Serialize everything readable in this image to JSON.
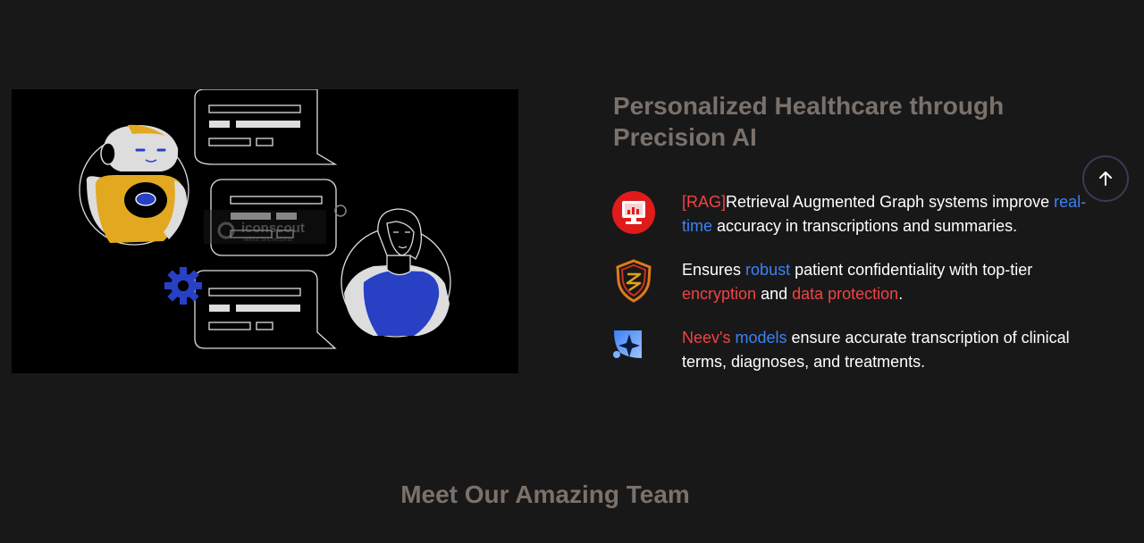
{
  "illustration": {
    "watermark_brand": "iconscout",
    "watermark_author": "Nikita Shcherbina"
  },
  "section": {
    "heading": "Personalized Healthcare through Precision AI",
    "features": [
      {
        "icon": "monitor-analytics-icon",
        "parts": [
          {
            "text": "[RAG]",
            "color": "red"
          },
          {
            "text": "Retrieval Augmented Graph systems improve ",
            "color": "white"
          },
          {
            "text": "real-time",
            "color": "blue"
          },
          {
            "text": " accuracy in transcriptions and summaries.",
            "color": "white"
          }
        ]
      },
      {
        "icon": "shield-icon",
        "parts": [
          {
            "text": "Ensures ",
            "color": "white"
          },
          {
            "text": "robust",
            "color": "blue"
          },
          {
            "text": " patient confidentiality with top-tier ",
            "color": "white"
          },
          {
            "text": "encryption",
            "color": "red"
          },
          {
            "text": " and ",
            "color": "white"
          },
          {
            "text": "data protection",
            "color": "red"
          },
          {
            "text": ".",
            "color": "white"
          }
        ]
      },
      {
        "icon": "sparkle-model-icon",
        "parts": [
          {
            "text": "Neev's",
            "color": "red"
          },
          {
            "text": " ",
            "color": "white"
          },
          {
            "text": "models",
            "color": "blue"
          },
          {
            "text": " ensure accurate transcription of clinical terms, diagnoses, and treatments.",
            "color": "white"
          }
        ]
      }
    ]
  },
  "scroll_top": {
    "icon": "arrow-up-icon"
  },
  "team": {
    "title": "Meet Our Amazing Team"
  },
  "colors": {
    "background": "#191818",
    "heading": "#7a716b",
    "red": "#ef4444",
    "blue": "#3b82f6",
    "robot_yellow": "#e2a81f",
    "avatar_blue": "#2740c4"
  }
}
